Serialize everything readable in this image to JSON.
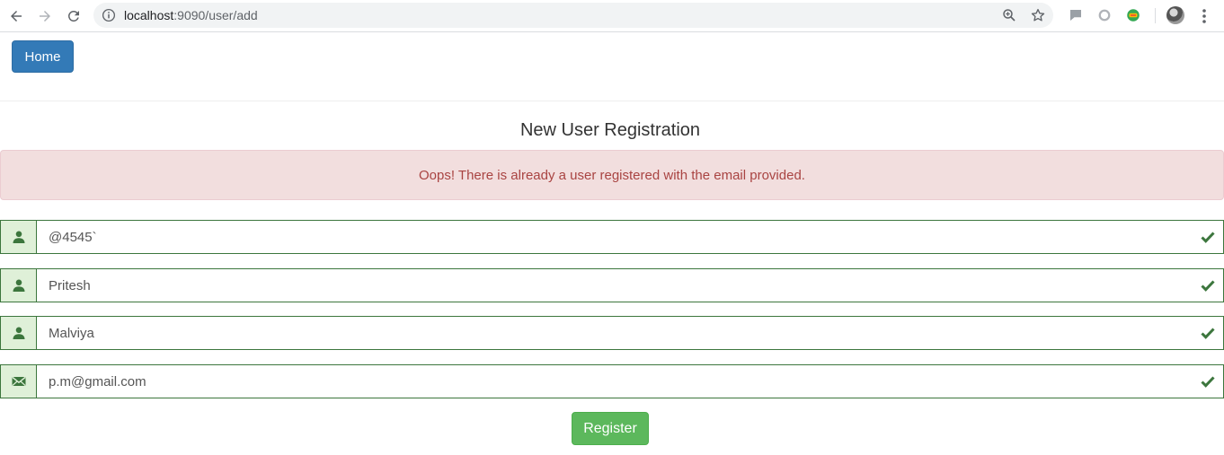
{
  "browser": {
    "url_host": "localhost",
    "url_path": ":9090/user/add",
    "icons": {
      "back": "back-arrow-icon",
      "forward": "forward-arrow-icon",
      "reload": "reload-icon",
      "info": "info-icon",
      "zoom": "zoom-icon",
      "bookmark": "star-icon",
      "menu": "more-vert-icon"
    }
  },
  "nav": {
    "home_label": "Home"
  },
  "page": {
    "title": "New User Registration"
  },
  "alert": {
    "message": "Oops! There is already a user registered with the email provided."
  },
  "form": {
    "fields": [
      {
        "icon": "user-icon",
        "value": "@4545`"
      },
      {
        "icon": "user-icon",
        "value": "Pritesh"
      },
      {
        "icon": "user-icon",
        "value": "Malviya"
      },
      {
        "icon": "envelope-icon",
        "value": "p.m@gmail.com"
      }
    ],
    "submit_label": "Register"
  },
  "colors": {
    "primary": "#337ab7",
    "success": "#5cb85c",
    "success_border": "#3c763d",
    "success_bg": "#dff0d8",
    "danger_text": "#a94442",
    "danger_bg": "#f2dede"
  }
}
